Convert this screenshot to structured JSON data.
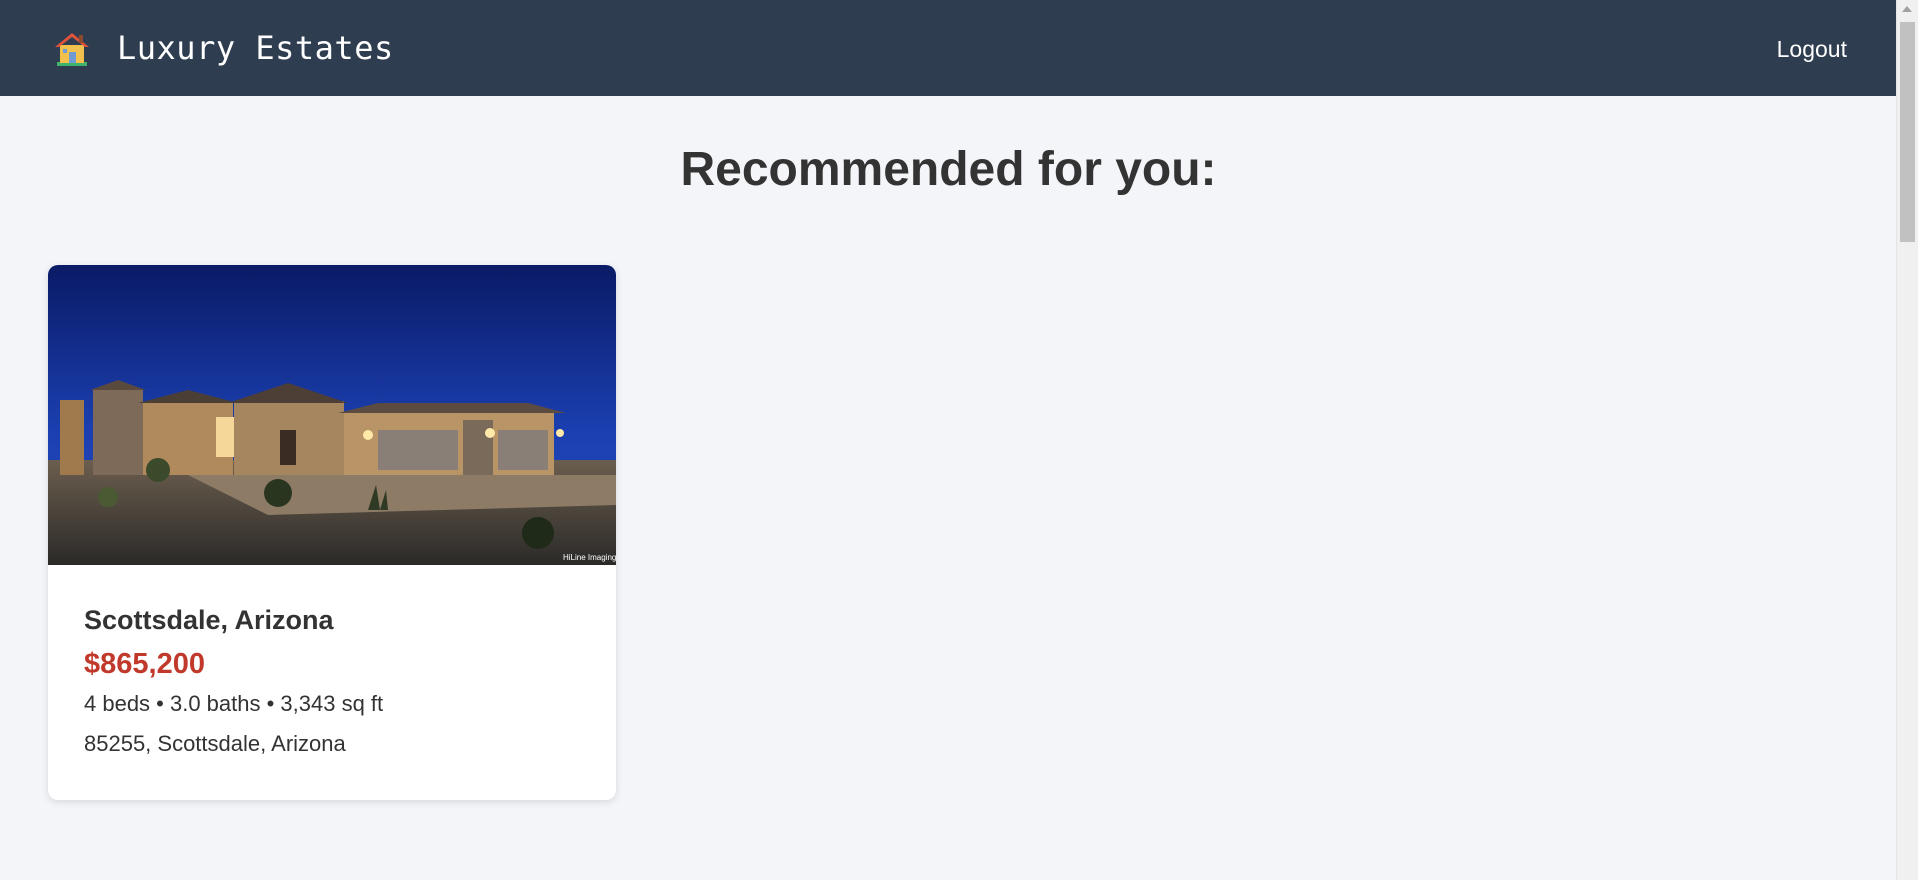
{
  "header": {
    "brand_name": "Luxury Estates",
    "logout_label": "Logout",
    "background_color": "#2e3d50",
    "icon": "house-icon"
  },
  "main": {
    "title": "Recommended for you:"
  },
  "listings": [
    {
      "location": "Scottsdale, Arizona",
      "price": "$865,200",
      "details": "4 beds • 3.0 baths • 3,343 sq ft",
      "address": "85255, Scottsdale, Arizona",
      "image_credit": "HiLine Imaging",
      "price_color": "#c0392b"
    }
  ]
}
